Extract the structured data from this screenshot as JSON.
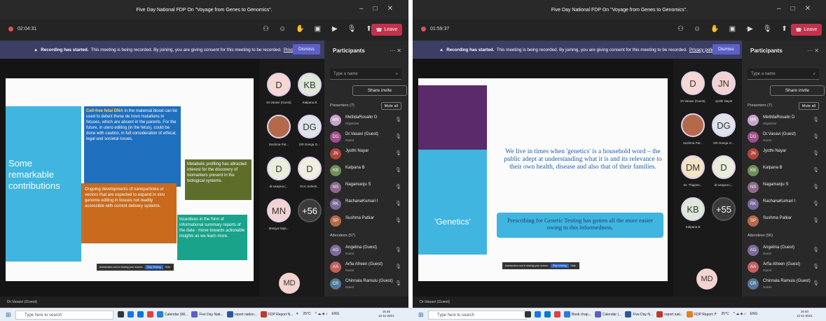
{
  "left": {
    "title": "Five Day National FDP On \"Voyage from Genes to Genomics\".",
    "timer": "02:04:31",
    "leave": "Leave",
    "banner": {
      "bold": "Recording has started.",
      "text": "This meeting is being recorded. By joining, you are giving consent for this meeting to be recorded.",
      "link": "Privacy policy",
      "dismiss": "Dismiss"
    },
    "slide": {
      "heading": "Some remarkable contributions",
      "box1_bold": "Cell-free fetal DNA",
      "box1": "in the maternal blood can be used to detect these de novo mutations in fetuses, which are absent in the parents. For the future, in utero editing (in the fetus), could be done with caution, in full consideration of ethical, legal and societal issues.",
      "box2": "Metabolic profiling has attracted interest for the discovery of biomarkers present in the biological systems.",
      "box3": "Ongoing developments of nanoparticles or vectors that are expected to expand in vivo genome editing in tissues not readily accessible with current delivery systems.",
      "box4": "Incentives in the form of informational summary reports of the data - move towards actionable insights as we learn more.",
      "share": "teamsnotes.com is sharing your screen.",
      "stop": "Stop sharing",
      "hide": "Hide"
    },
    "tiles": [
      {
        "init": "D",
        "label": "Dr.Vasavi (Guest)",
        "color": "#f6d7d3"
      },
      {
        "init": "KB",
        "label": "Kalpana B",
        "color": "#dde8d9"
      },
      {
        "init": "",
        "label": "Sushma Pat...",
        "color": "#b46a4a"
      },
      {
        "init": "DG",
        "label": "DR.Ganga G...",
        "color": "#dfe3ea"
      },
      {
        "init": "D",
        "label": "dr.swapna (...",
        "color": "#e8eed9"
      },
      {
        "init": "D",
        "label": "Dr.K.Selesti...",
        "color": "#f0eede"
      },
      {
        "init": "MN",
        "label": "Manjya Naja...",
        "color": "#f3d3d0"
      },
      {
        "init": "+56",
        "label": "",
        "color": "#3a3a3a"
      }
    ],
    "self": "MD",
    "status": "Dr.Vasavi (Guest)",
    "participants": {
      "title": "Participants",
      "search": "Type a name",
      "invite": "Share invite",
      "presenters": "Presenters (7)",
      "muteall": "Mute all",
      "attendees": "Attendees (57)",
      "list": [
        {
          "init": "MR",
          "name": "MetildaRosalin D",
          "role": "Organizer",
          "color": "#c8a2c8"
        },
        {
          "init": "DG",
          "name": "Dr.Vasavi (Guest)",
          "role": "Guest",
          "color": "#a0508a"
        },
        {
          "init": "JN",
          "name": "Jyothi Nayar",
          "role": "",
          "color": "#b0463c"
        },
        {
          "init": "KB",
          "name": "Kalpana B",
          "role": "",
          "color": "#6f8f5a"
        },
        {
          "init": "NS",
          "name": "Nagamanju S",
          "role": "",
          "color": "#8c6b8a"
        },
        {
          "init": "RK",
          "name": "RachanaKumari I",
          "role": "",
          "color": "#7a6a9a"
        },
        {
          "init": "SP",
          "name": "Sushma Patkar",
          "role": "",
          "color": "#b46a4a"
        }
      ],
      "attendees_list": [
        {
          "init": "AG",
          "name": "Angelina (Guest)",
          "role": "Guest",
          "color": "#7d6b9b"
        },
        {
          "init": "AA",
          "name": "Arfia Afreen (Guest)",
          "role": "Guest",
          "color": "#c06060"
        },
        {
          "init": "CR",
          "name": "Chinnala Ramulu (Guest)",
          "role": "Guest",
          "color": "#557799"
        }
      ]
    },
    "taskbar": {
      "search": "Type here to search",
      "apps": [
        "Calendar (Wi...",
        "Five Day Nati...",
        "report nation...",
        "FDP Report N..."
      ],
      "temp": "25°C",
      "lang": "ENG",
      "time": "16:45",
      "date": "12-11-2021"
    }
  },
  "right": {
    "title": "Five Day National FDP On \"Voyage from Genes to Genomics\".",
    "timer": "01:59:37",
    "leave": "Leave",
    "banner": {
      "bold": "Recording has started.",
      "text": "This meeting is being recorded. By joining, you are giving consent for this meeting to be recorded.",
      "link": "Privacy policy",
      "dismiss": "Dismiss"
    },
    "slide": {
      "heading": "'Genetics'",
      "main": "We live in times when 'genetics' is a household word – the public adept at understanding what it is and its relevance to their own health, disease and also that of their families.",
      "box": "Prescribing for Genetic Testing has gotten all the more easier owing to this informedness.",
      "share": "teamsnotes.com is sharing your screen.",
      "stop": "Stop sharing",
      "hide": "Hide"
    },
    "tiles": [
      {
        "init": "D",
        "label": "Dr.Vasavi (Guest)",
        "color": "#f6d7d3"
      },
      {
        "init": "JN",
        "label": "Jyothi Nayar",
        "color": "#f3d3d0"
      },
      {
        "init": "",
        "label": "Sushma Pat...",
        "color": "#b46a4a"
      },
      {
        "init": "DG",
        "label": "DR.Ganga G...",
        "color": "#dfe3ea"
      },
      {
        "init": "DM",
        "label": "Dr. Thippes...",
        "color": "#f5e4c3"
      },
      {
        "init": "D",
        "label": "dr.swapna (...",
        "color": "#e8eed9"
      },
      {
        "init": "KB",
        "label": "Kalpana B",
        "color": "#dde8d9"
      },
      {
        "init": "+55",
        "label": "",
        "color": "#3a3a3a"
      }
    ],
    "self": "MD",
    "status": "Dr.Vasavi (Guest)",
    "participants": {
      "title": "Participants",
      "search": "Type a name",
      "invite": "Share invite",
      "presenters": "Presenters (7)",
      "muteall": "Mute all",
      "attendees": "Attendees (56)",
      "list": [
        {
          "init": "MR",
          "name": "MetildaRosalin D",
          "role": "Organizer",
          "color": "#c8a2c8"
        },
        {
          "init": "DG",
          "name": "Dr.Vasavi (Guest)",
          "role": "Guest",
          "color": "#a0508a"
        },
        {
          "init": "JN",
          "name": "Jyothi Nayar",
          "role": "",
          "color": "#b0463c"
        },
        {
          "init": "KB",
          "name": "Kalpana B",
          "role": "",
          "color": "#6f8f5a"
        },
        {
          "init": "NS",
          "name": "Nagamanju S",
          "role": "",
          "color": "#8c6b8a"
        },
        {
          "init": "RK",
          "name": "RachanaKumari I",
          "role": "",
          "color": "#7a6a9a"
        },
        {
          "init": "SP",
          "name": "Sushma Patkar",
          "role": "",
          "color": "#b46a4a"
        }
      ],
      "attendees_list": [
        {
          "init": "AG",
          "name": "Angelina (Guest)",
          "role": "Guest",
          "color": "#7d6b9b"
        },
        {
          "init": "AA",
          "name": "Arfia Afreen (Guest)",
          "role": "Guest",
          "color": "#c06060"
        },
        {
          "init": "CR",
          "name": "Chinnala Ramulu (Guest)",
          "role": "Guest",
          "color": "#557799"
        }
      ]
    },
    "taskbar": {
      "search": "Type here to search",
      "apps": [
        "Book chap...",
        "Calendar (...",
        "Five Day N...",
        "report nati...",
        "FDP Report..."
      ],
      "temp": "25°C",
      "lang": "ENG",
      "time": "16:40",
      "date": "12-11-2021"
    }
  }
}
